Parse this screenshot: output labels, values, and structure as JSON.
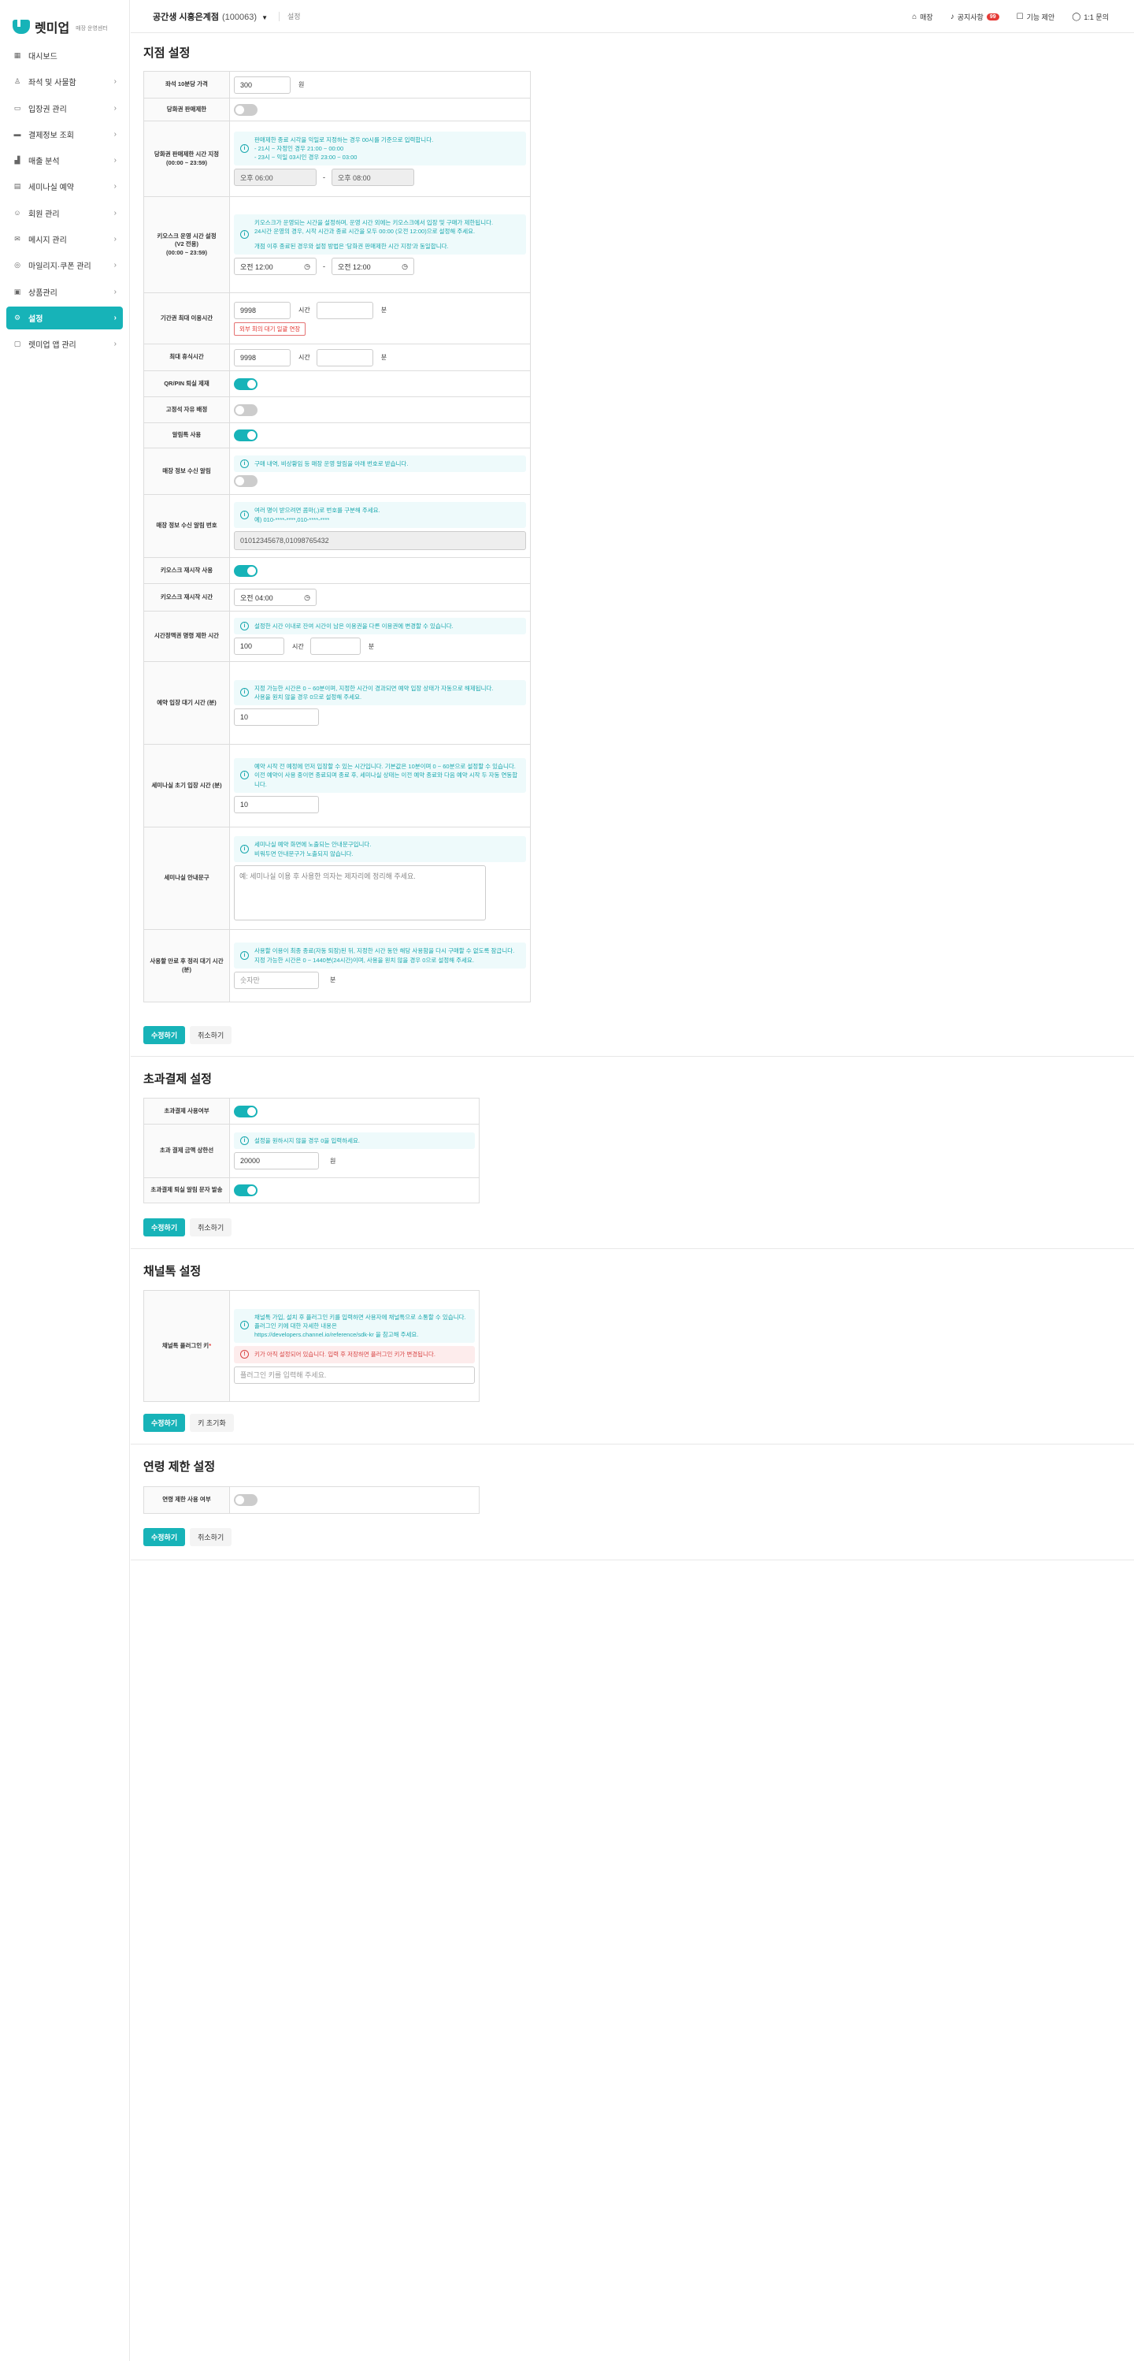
{
  "brand": {
    "name": "렛미업",
    "sub": "매장 운영센터"
  },
  "nav": [
    {
      "label": "대시보드",
      "icon": "grid-icon",
      "chev": false
    },
    {
      "label": "좌석 및 사물함",
      "icon": "seat-icon",
      "chev": true
    },
    {
      "label": "입장권 관리",
      "icon": "ticket-icon",
      "chev": true
    },
    {
      "label": "결제정보 조회",
      "icon": "card-icon",
      "chev": true
    },
    {
      "label": "매출 분석",
      "icon": "chart-icon",
      "chev": true
    },
    {
      "label": "세미나실 예약",
      "icon": "calendar-icon",
      "chev": true
    },
    {
      "label": "회원 관리",
      "icon": "user-icon",
      "chev": true
    },
    {
      "label": "메시지 관리",
      "icon": "mail-icon",
      "chev": true
    },
    {
      "label": "마일리지·쿠폰 관리",
      "icon": "coupon-icon",
      "chev": true
    },
    {
      "label": "상품관리",
      "icon": "box-icon",
      "chev": true
    },
    {
      "label": "설정",
      "icon": "gear-icon",
      "chev": true,
      "active": true
    },
    {
      "label": "렛미업 앱 관리",
      "icon": "app-icon",
      "chev": true
    }
  ],
  "header": {
    "store": "공간생 시흥은계점",
    "code": "(100063)",
    "crumb": "설정",
    "right": [
      {
        "label": "매장",
        "icon": "store-icon"
      },
      {
        "label": "공지사항",
        "icon": "bell-icon",
        "badge": "99"
      },
      {
        "label": "기능 제안",
        "icon": "chat-icon"
      },
      {
        "label": "1:1 문의",
        "icon": "message-icon"
      }
    ]
  },
  "branch": {
    "title": "지점 설정",
    "price_label": "좌석 10분당 가격",
    "price_value": "300",
    "price_unit": "원",
    "daily_limit_label": "당화권 판매제한",
    "daily_time_label": "당화권 판매제한 시간 지정\n(00:00 ~ 23:59)",
    "daily_time_info": [
      "판매제한 종료 시각을 익일로 지정하는 경우 00시를 기준으로 입력합니다.",
      "- 21시 ~ 자정인 경우 21:00 ~ 00:00",
      "- 23시 ~ 익일 03시인 경우 23:00 ~ 03:00"
    ],
    "daily_time_start": "오후 06:00",
    "daily_time_end": "오후 08:00",
    "dash": "-",
    "kiosk_label": "키오스크 운영 시간 설정\n(V2 전용)\n(00:00 ~ 23:59)",
    "kiosk_info": [
      "키오스크가 운영되는 시간을 설정하며, 운영 시간 외에는 키오스크에서 입장 및 구매가 제한됩니다.",
      "24시간 운영의 경우, 시작 시간과 종료 시간을 모두 00:00 (오전 12:00)으로 설정해 주세요.",
      "",
      "개점 이후 종료된 경우와 설정 방법은 '당화권 판매제한 시간 지정'과 동일합니다."
    ],
    "kiosk_start": "오전 12:00",
    "kiosk_end": "오전 12:00",
    "period_label": "기간권 최대 이용시간",
    "period_value": "9998",
    "period_hour": "시간",
    "period_min_unit": "분",
    "period_tag": "외부 회의 대기 일괄 연장",
    "max_rest_label": "최대 휴식시간",
    "max_rest_value": "9998",
    "max_rest_hour": "시간",
    "max_rest_min_unit": "분",
    "qr_label": "QR/PIN 퇴실 제재",
    "fixed_label": "고정석 자유 배정",
    "alimtalk_label": "알림톡 사용",
    "notice_recv_label": "매장 정보 수신 알림",
    "notice_recv_info": "구매 내역, 비상황임 등 매장 운영 알림을 아래 번호로 받습니다.",
    "phones_label": "매장 정보 수신 알림 번호",
    "phones_info": [
      "여러 명이 받으려면 콤마(,)로 번호를 구분해 주세요.",
      "예) 010-****-****,010-****-****"
    ],
    "phones_value": "01012345678,01098765432",
    "kiosk_restart_label": "키오스크 재시작 사용",
    "kiosk_restart_time_label": "키오스크 재시작 시간",
    "kiosk_restart_time": "오전 04:00",
    "time_limit_label": "시간정액권 명령 제한 시간",
    "time_limit_info": "설정한 시간 이내로 잔여 시간이 남은 이용권을 다른 이용권에 변경할 수 있습니다.",
    "time_limit_value": "100",
    "time_limit_hour": "시간",
    "time_limit_min_unit": "분",
    "reserve_label": "예약 입장 대기 시간 (분)",
    "reserve_info": [
      "지정 가능한 시간은 0 ~ 60분이며, 지정한 시간이 경과되면 예약 입장 상태가 자동으로 해제됩니다.",
      "사용을 원치 않을 경우 0으로 설정해 주세요."
    ],
    "reserve_value": "10",
    "seminar_init_label": "세미나실 초기 입장 시간 (분)",
    "seminar_init_info": [
      "예약 시작 전 예정에 먼저 입장할 수 있는 시간입니다. 기본값은 10분이며 0 ~ 60분으로 설정할 수 있습니다.",
      "이전 예약이 사용 중이면 종료되며 종료 후, 세미나실 상태는 이전 예약 종료와 다음 예약 시작 두 자동 연동합니다."
    ],
    "seminar_init_value": "10",
    "seminar_guide_label": "세미나실 안내문구",
    "seminar_guide_info": [
      "세미나실 예약 화면에 노출되는 안내문구입니다.",
      "비워두면 안내문구가 노출되지 않습니다."
    ],
    "seminar_guide_placeholder": "예: 세미나실 이용 후 사용한 의자는 제자리에 정리해 주세요.",
    "seat_wait_label": "사용할 만료 후 정리 대기 시간 (분)",
    "seat_wait_info": [
      "사용할 이용이 최종 종료(자동 퇴장)된 뒤, 지정한 시간 동안 해당 사용함을 다시 구매할 수 없도록 잠급니다.",
      "지정 가능한 시간은 0 ~ 1440분(24시간)이며, 사용을 원치 않을 경우 0으로 설정해 주세요."
    ],
    "seat_wait_placeholder": "숫자만",
    "seat_wait_unit": "분",
    "save": "수정하기",
    "cancel": "취소하기"
  },
  "overpay": {
    "title": "초과결제 설정",
    "use_label": "초과결제 사용여부",
    "limit_label": "초과 결제 금액 상한선",
    "limit_info": "설정을 원하시지 않을 경우 0을 입력하세요.",
    "limit_value": "20000",
    "limit_unit": "원",
    "sms_label": "초과결제 퇴실 알림 문자 발송",
    "save": "수정하기",
    "cancel": "취소하기"
  },
  "channel": {
    "title": "채널톡 설정",
    "key_label": "채널톡 플러그인 키",
    "req": "*",
    "info": [
      "채널톡 가입, 설치 후 플러그인 키를 입력하면 사용자에 채널톡으로 소통할 수 있습니다.",
      "플러그인 키에 대한 자세한 내용은",
      "https://developers.channel.io/reference/sdk-kr 을 참고해 주세요."
    ],
    "err": "키가 아직 설정되어 있습니다. 입력 후 저장하면 플러그인 키가 변경됩니다.",
    "placeholder": "플러그인 키를 입력해 주세요.",
    "save": "수정하기",
    "reset": "키 초기화"
  },
  "age": {
    "title": "연령 제한 설정",
    "use_label": "연령 제한 사용 여부",
    "save": "수정하기",
    "cancel": "취소하기"
  },
  "colors": {
    "accent": "#17b3b8",
    "danger": "#e53935"
  }
}
